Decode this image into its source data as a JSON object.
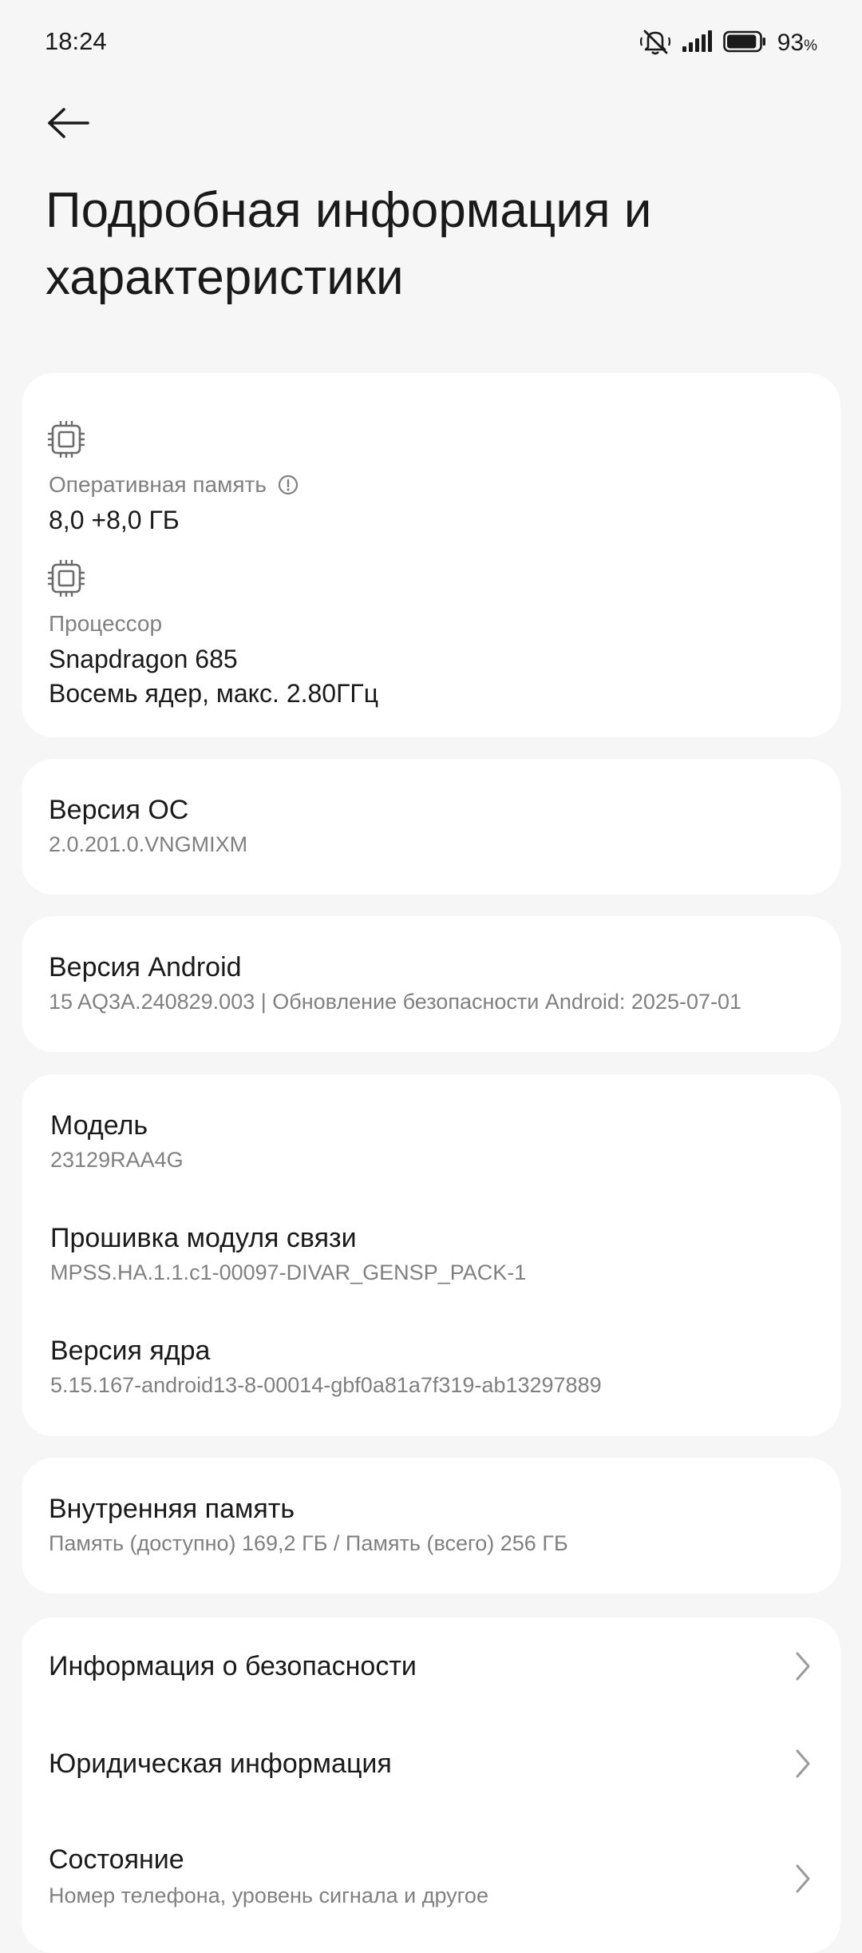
{
  "status_bar": {
    "time": "18:24",
    "battery_percent": "93",
    "battery_unit": "%",
    "battery_level": 0.93,
    "icons": [
      "mute-icon",
      "signal-icon",
      "battery-icon"
    ]
  },
  "header": {
    "back_icon": "arrow-left-icon",
    "title": "Подробная информация и характеристики"
  },
  "hardware": {
    "ram_label": "Оперативная память",
    "ram_value": "8,0 +8,0 ГБ",
    "cpu_label": "Процессор",
    "cpu_model": "Snapdragon 685",
    "cpu_details": "Восемь ядер, макс. 2.80ГГц",
    "icon": "chip-icon"
  },
  "os": {
    "title": "Версия ОС",
    "value": "2.0.201.0.VNGMIXM"
  },
  "android": {
    "title": "Версия Android",
    "value": "15 AQ3A.240829.003 | Обновление безопасности Android: 2025-07-01"
  },
  "device": {
    "model_title": "Модель",
    "model_value": "23129RAA4G",
    "baseband_title": "Прошивка модуля связи",
    "baseband_value": "MPSS.HA.1.1.c1-00097-DIVAR_GENSP_PACK-1",
    "kernel_title": "Версия ядра",
    "kernel_value": "5.15.167-android13-8-00014-gbf0a81a7f319-ab13297889"
  },
  "storage": {
    "title": "Внутренняя память",
    "value": "Память (доступно)  169,2 ГБ / Память (всего)  256 ГБ"
  },
  "links": [
    {
      "title": "Информация о безопасности",
      "subtitle": ""
    },
    {
      "title": "Юридическая информация",
      "subtitle": ""
    },
    {
      "title": "Состояние",
      "subtitle": "Номер телефона, уровень сигнала и другое"
    }
  ],
  "colors": {
    "background": "#f6f6f6",
    "card": "#ffffff",
    "primary_text": "#1a1a1a",
    "secondary_text": "#808080"
  }
}
